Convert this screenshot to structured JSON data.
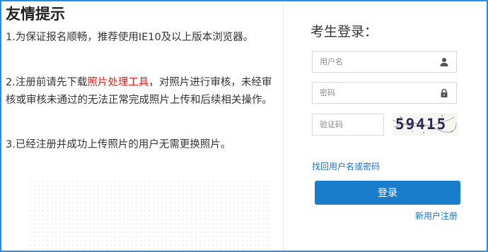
{
  "notice": {
    "title": "友情提示",
    "item1": "1.为保证报名顺畅，推荐使用IE10及以上版本浏览器。",
    "item2_prefix": "2.注册前请先下载",
    "item2_link": "照片处理工具",
    "item2_suffix": "，对照片进行审核，未经审核或审核未通过的无法正常完成照片上传和后续相关操作。",
    "item3": "3.已经注册并成功上传照片的用户无需更换照片。"
  },
  "login": {
    "title": "考生登录：",
    "username_placeholder": "用户名",
    "password_placeholder": "密码",
    "captcha_placeholder": "验证码",
    "captcha_text": "59415",
    "forgot_link": "找回用户名或密码",
    "submit_label": "登录",
    "register_link": "新用户注册"
  },
  "icons": {
    "username": "user-icon",
    "password": "lock-icon"
  },
  "colors": {
    "frame_border": "#1f8fe8",
    "highlight_red": "#e8201b",
    "link_blue": "#1a73c9",
    "button_blue": "#1a7dcc"
  }
}
